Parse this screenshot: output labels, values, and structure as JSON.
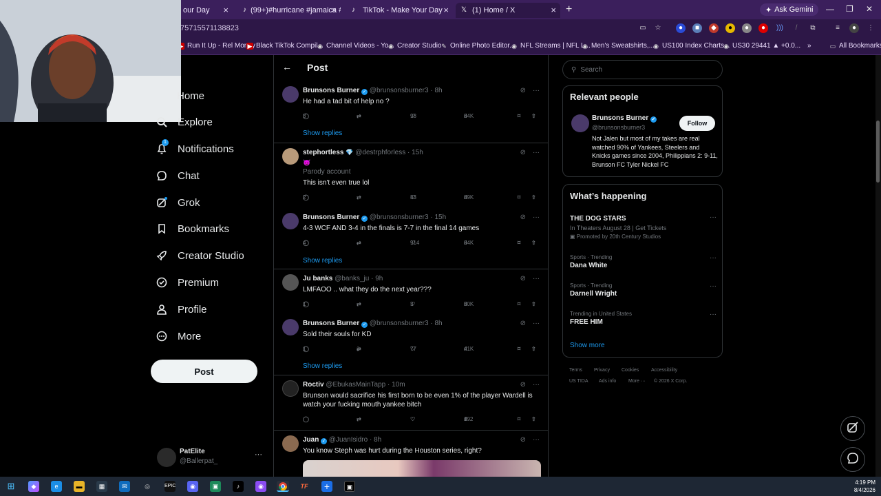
{
  "browser": {
    "tabs": [
      {
        "label": "our Day"
      },
      {
        "label": "(99+)#hurricane #jamaica #wea"
      },
      {
        "label": "TikTok - Make Your Day"
      },
      {
        "label": "(1) Home / X"
      }
    ],
    "gemini_label": "Ask Gemini",
    "url": "75715571138823",
    "bookmarks": [
      "Run It Up - Rel Money",
      "Black TikTok Compil...",
      "Channel Videos - Yo...",
      "Creator Studio",
      "Online Photo Editor...",
      "NFL Streams | NFL L...",
      "Men's Sweatshirts,...",
      "US100 Index Charts...",
      "US30 29441 ▲ +0.0..."
    ],
    "all_bookmarks": "All Bookmarks"
  },
  "nav": {
    "items": [
      {
        "label": "Home",
        "icon": "home-icon"
      },
      {
        "label": "Explore",
        "icon": "search-icon"
      },
      {
        "label": "Notifications",
        "icon": "bell-icon",
        "badge": "1"
      },
      {
        "label": "Chat",
        "icon": "chat-icon"
      },
      {
        "label": "Grok",
        "icon": "grok-icon"
      },
      {
        "label": "Bookmarks",
        "icon": "bookmark-icon"
      },
      {
        "label": "Creator Studio",
        "icon": "rocket-icon"
      },
      {
        "label": "Premium",
        "icon": "verified-icon"
      },
      {
        "label": "Profile",
        "icon": "person-icon"
      },
      {
        "label": "More",
        "icon": "more-circle-icon"
      }
    ],
    "post_button": "Post",
    "account": {
      "name": "PatElite",
      "handle": "@Ballerpat_",
      "menu": "···"
    }
  },
  "main": {
    "title": "Post",
    "show_replies": "Show replies",
    "tweets": [
      {
        "name": "Brunsons Burner",
        "verified": true,
        "handle": "@brunsonsburner3",
        "time": "8h",
        "text": "He had a tad bit of help no ?",
        "replies": "3",
        "retweets": "",
        "likes": "98",
        "views": "84K"
      },
      {
        "name": "stephortless",
        "diamond": "💎",
        "handle": "@destrphforless",
        "time": "15h",
        "emoji": "😈",
        "parody": "Parody account",
        "text": "This isn't even true lol",
        "replies": "2",
        "retweets": "",
        "likes": "83",
        "views": "89K"
      },
      {
        "name": "Brunsons Burner",
        "verified": true,
        "handle": "@brunsonsburner3",
        "time": "15h",
        "text": "4-3 WCF AND 3-4 in the finals is 7-7 in the final 14 games",
        "replies": "4",
        "retweets": "",
        "likes": "914",
        "views": "84K"
      },
      {
        "name": "Ju banks",
        "handle": "@banks_ju",
        "time": "9h",
        "text": "LMFAOO .. what they do the next year???",
        "replies": "1",
        "retweets": "",
        "likes": "3",
        "views": "50K"
      },
      {
        "name": "Brunsons Burner",
        "verified": true,
        "handle": "@brunsonsburner3",
        "time": "8h",
        "text": "Sold their souls for KD",
        "replies": "1",
        "retweets": "1",
        "likes": "77",
        "views": "41K"
      },
      {
        "name": "Roctiv",
        "handle": "@EbukasMainTapp",
        "time": "10m",
        "text": "Brunson would sacrifice his first born to be even 1% of the player Wardell is watch your fucking mouth yankee bitch",
        "replies": "",
        "retweets": "",
        "likes": "",
        "views": "192"
      },
      {
        "name": "Juan",
        "verified": true,
        "handle": "@JuanIsidro",
        "time": "8h",
        "text": "You know Steph was hurt during the Houston series, right?"
      }
    ]
  },
  "right": {
    "search_placeholder": "Search",
    "relevant_title": "Relevant people",
    "person": {
      "name": "Brunsons Burner",
      "handle": "@brunsonsburner3",
      "follow": "Follow",
      "bio": "Not Jalen but most of my takes are real watched 90% of Yankees, Steelers and Knicks games since 2004, Philippians 2: 9-11, Brunson FC Tyler Nickel FC"
    },
    "happening_title": "What’s happening",
    "trends": [
      {
        "small": "",
        "big": "THE DOG STARS",
        "sub": "In Theaters August 28 | Get Tickets",
        "promo": "Promoted by 20th Century Studios"
      },
      {
        "small": "Sports · Trending",
        "big": "Dana White"
      },
      {
        "small": "Sports · Trending",
        "big": "Darnell Wright"
      },
      {
        "small": "Trending in United States",
        "big": "FREE HIM"
      }
    ],
    "show_more": "Show more",
    "footer_line1": [
      "Terms",
      "Privacy",
      "Cookies",
      "Accessibility"
    ],
    "footer_line2": [
      "US TIDA",
      "Ads info",
      "More ···",
      "© 2026 X Corp."
    ]
  },
  "taskbar": {
    "time": "4:19 PM",
    "date": "8/4/2026"
  },
  "colors": {
    "accent": "#1d9bf0",
    "chrome": "#3b1f5c"
  }
}
